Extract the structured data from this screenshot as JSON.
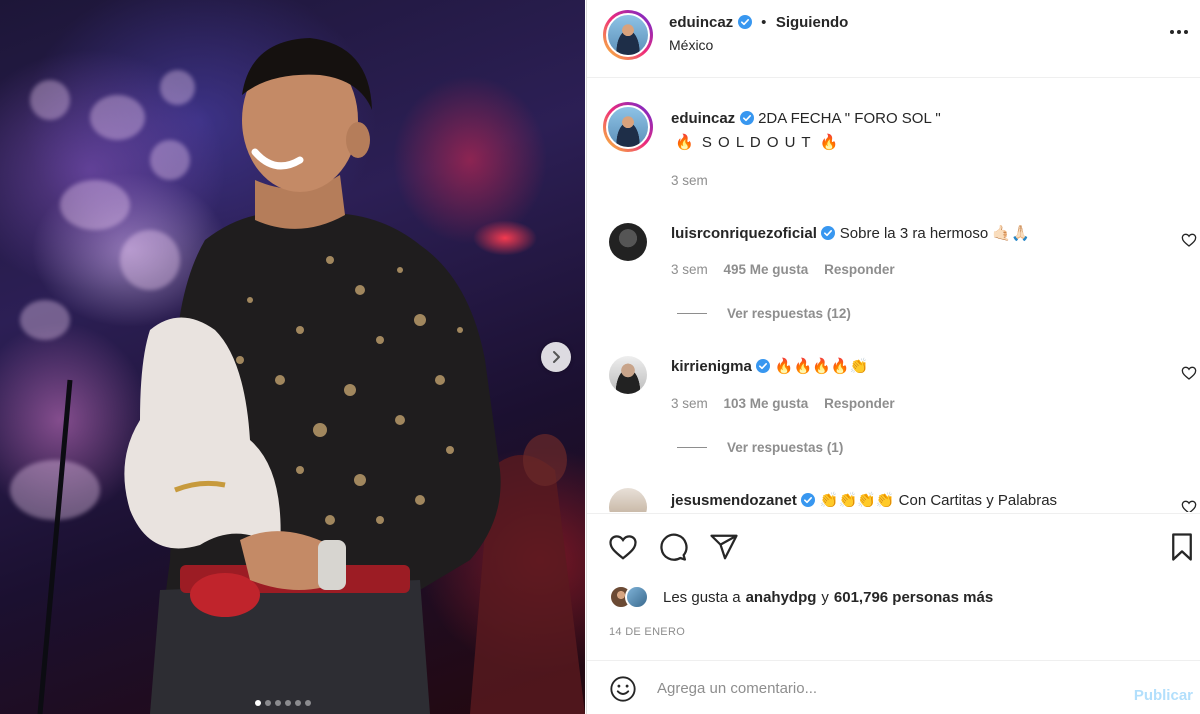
{
  "post": {
    "images_count": 6,
    "active_image": 1
  },
  "header": {
    "username": "eduincaz",
    "separator": "•",
    "follow_label": "Siguiendo",
    "location": "México"
  },
  "caption": {
    "username": "eduincaz",
    "line1": "2DA FECHA \" FORO SOL \"",
    "line2_prefix": "🔥",
    "line2_text": "S O L D O U T",
    "line2_suffix": "🔥",
    "time": "3 sem"
  },
  "comments": [
    {
      "username": "luisrconriquezoficial",
      "text": "Sobre la 3 ra hermoso 🤙🏻🙏🏻",
      "time": "3 sem",
      "likes": "495 Me gusta",
      "reply": "Responder",
      "view_replies": "Ver respuestas (12)"
    },
    {
      "username": "kirrienigma",
      "text": "🔥🔥🔥🔥👏",
      "time": "3 sem",
      "likes": "103 Me gusta",
      "reply": "Responder",
      "view_replies": "Ver respuestas (1)"
    },
    {
      "username": "jesusmendozanet",
      "text": "👏👏👏👏 Con Cartitas y Palabras"
    }
  ],
  "likes": {
    "prefix": "Les gusta a",
    "user": "anahydpg",
    "middle": "y",
    "count": "601,796 personas más"
  },
  "date": "14 DE ENERO",
  "add_comment": {
    "placeholder": "Agrega un comentario...",
    "publish": "Publicar"
  },
  "colors": {
    "verified": "#3897f0",
    "publish_disabled": "#b2dffc",
    "secondary_text": "#8e8e8e"
  }
}
